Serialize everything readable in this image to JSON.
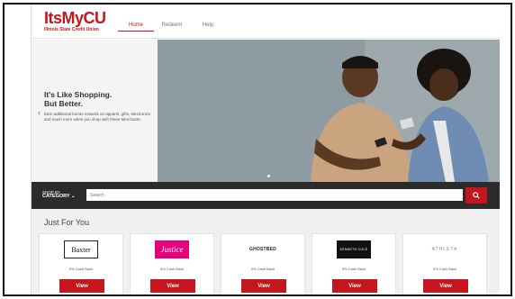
{
  "header": {
    "logo_main": "ItsMyCU",
    "logo_sub": "Illinois State Credit Union",
    "nav": [
      {
        "label": "Home",
        "active": true
      },
      {
        "label": "Redeem",
        "active": false
      },
      {
        "label": "Help",
        "active": false
      }
    ]
  },
  "hero": {
    "title_line1": "It's Like Shopping.",
    "title_line2": "But Better.",
    "description": "Earn additional bonus rewards on apparel, gifts, electronics and much more when you shop with these Merchants.",
    "prev_icon": "chevron-left-icon"
  },
  "searchbar": {
    "shop_by": "SHOP BY",
    "category": "CATEGORY",
    "placeholder": "Search",
    "search_icon": "search-icon"
  },
  "just_for_you": {
    "title": "Just For You",
    "merchants": [
      {
        "name": "Baxter",
        "cashback": "5% Cash Back",
        "button": "View"
      },
      {
        "name": "Justice",
        "cashback": "5% Cash Back",
        "button": "View"
      },
      {
        "name": "GHOSTBED",
        "cashback": "5% Cash Back",
        "button": "View"
      },
      {
        "name": "KENNETH COLE",
        "cashback": "5% Cash Back",
        "button": "View"
      },
      {
        "name": "ATHLETA",
        "cashback": "5% Cash Back",
        "button": "View"
      }
    ]
  },
  "colors": {
    "brand_red": "#c4161c",
    "dark_bar": "#2b2b2b"
  }
}
